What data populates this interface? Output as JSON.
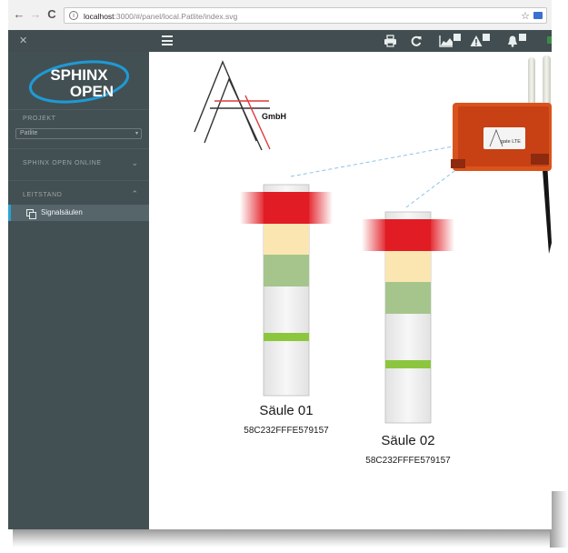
{
  "browser": {
    "url_host": "localhost",
    "url_path": ":3000/#/panel/local.Patlite/index.svg",
    "nav_back": "←",
    "nav_forward": "→",
    "nav_reload": "C"
  },
  "header": {
    "badges": [
      "",
      "",
      ""
    ]
  },
  "sidebar": {
    "logo_line1": "SPHINX",
    "logo_line2": "OPEN",
    "project_label": "PROJEKT",
    "project_value": "Patlite",
    "section_online": "SPHINX OPEN ONLINE",
    "section_leitstand": "LEITSTAND",
    "active_item": "Signalsäulen"
  },
  "canvas": {
    "company_logo_text": "GmbH",
    "device_label": "gate LTE",
    "towers": [
      {
        "name": "Säule 01",
        "id": "58C232FFFE579157"
      },
      {
        "name": "Säule 02",
        "id": "58C232FFFE579157"
      }
    ]
  },
  "colors": {
    "sidebar_bg": "#435053",
    "header_bg": "#414d50",
    "accent": "#29a3d6",
    "signal_red": "#e21c24",
    "signal_yellow": "#fbe6b1",
    "signal_green": "#a5c58c",
    "signal_bar_green": "#8cc63f"
  }
}
